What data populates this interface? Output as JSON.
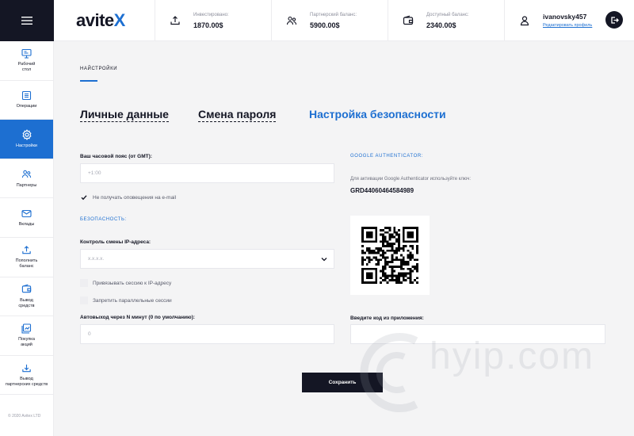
{
  "header": {
    "logo_part1": "avite",
    "logo_part2": "X",
    "stats": [
      {
        "label": "Инвестировано:",
        "value": "1870.00$",
        "icon": "upload-icon"
      },
      {
        "label": "Партнерский баланс:",
        "value": "5900.00$",
        "icon": "partners-icon"
      },
      {
        "label": "Доступный баланс:",
        "value": "2340.00$",
        "icon": "wallet-icon"
      }
    ],
    "user": {
      "username": "ivanovsky457",
      "edit_profile": "Редактировать профиль",
      "icon": "user-icon"
    },
    "logout_icon": "logout-icon"
  },
  "sidebar": {
    "items": [
      {
        "label": "Рабочий\nстол",
        "icon": "desktop-icon",
        "active": false
      },
      {
        "label": "Операции",
        "icon": "list-icon",
        "active": false
      },
      {
        "label": "Настройки",
        "icon": "gear-icon",
        "active": true
      },
      {
        "label": "Партнеры",
        "icon": "partners-icon",
        "active": false
      },
      {
        "label": "Вклады",
        "icon": "mail-icon",
        "active": false
      },
      {
        "label": "Пополнить\nбаланс",
        "icon": "upload-icon",
        "active": false
      },
      {
        "label": "Вывод\nсредств",
        "icon": "wallet-icon",
        "active": false
      },
      {
        "label": "Покупка\nакций",
        "icon": "chart-doc-icon",
        "active": false
      },
      {
        "label": "Вывод\nпартнерских средств",
        "icon": "download-icon",
        "active": false
      }
    ],
    "copyright": "© 2020 Avitex LTD"
  },
  "main": {
    "breadcrumb": "НАЙСТРОЙКИ",
    "tabs": [
      {
        "label": "Личные данные",
        "active": false
      },
      {
        "label": "Смена пароля",
        "active": false
      },
      {
        "label": "Настройка безопасности",
        "active": true
      }
    ],
    "timezone": {
      "label": "Ваш часовой пояс (от GMT):",
      "placeholder": "+1:00"
    },
    "no_email": {
      "label": "Не получать оповещения на e-mail",
      "checked": true
    },
    "security_title": "БЕЗОПАСНОСТЬ:",
    "ip_control": {
      "label": "Контроль смены IP-адреса:",
      "value": "x.x.x.x."
    },
    "bind_session": {
      "label": "Привязывать сессию к IP-адресу",
      "checked": false
    },
    "parallel_sessions": {
      "label": "Запретить параллельные сессии",
      "checked": false
    },
    "autologout": {
      "label": "Автовыход через N минут (0 по умолчанию):",
      "placeholder": "0"
    },
    "google": {
      "title": "GOOGLE AUTHENTICATOR:",
      "hint": "Для активации Google Authenticator используйте ключ:",
      "key": "GRD44060464584989",
      "code_label": "Введите код из приложения:",
      "code_placeholder": ""
    },
    "save_label": "Сохранить"
  },
  "watermark": {
    "text": "hyip.com"
  },
  "colors": {
    "accent": "#1d6fd1",
    "dark": "#141624",
    "background": "#f4f4f5"
  }
}
